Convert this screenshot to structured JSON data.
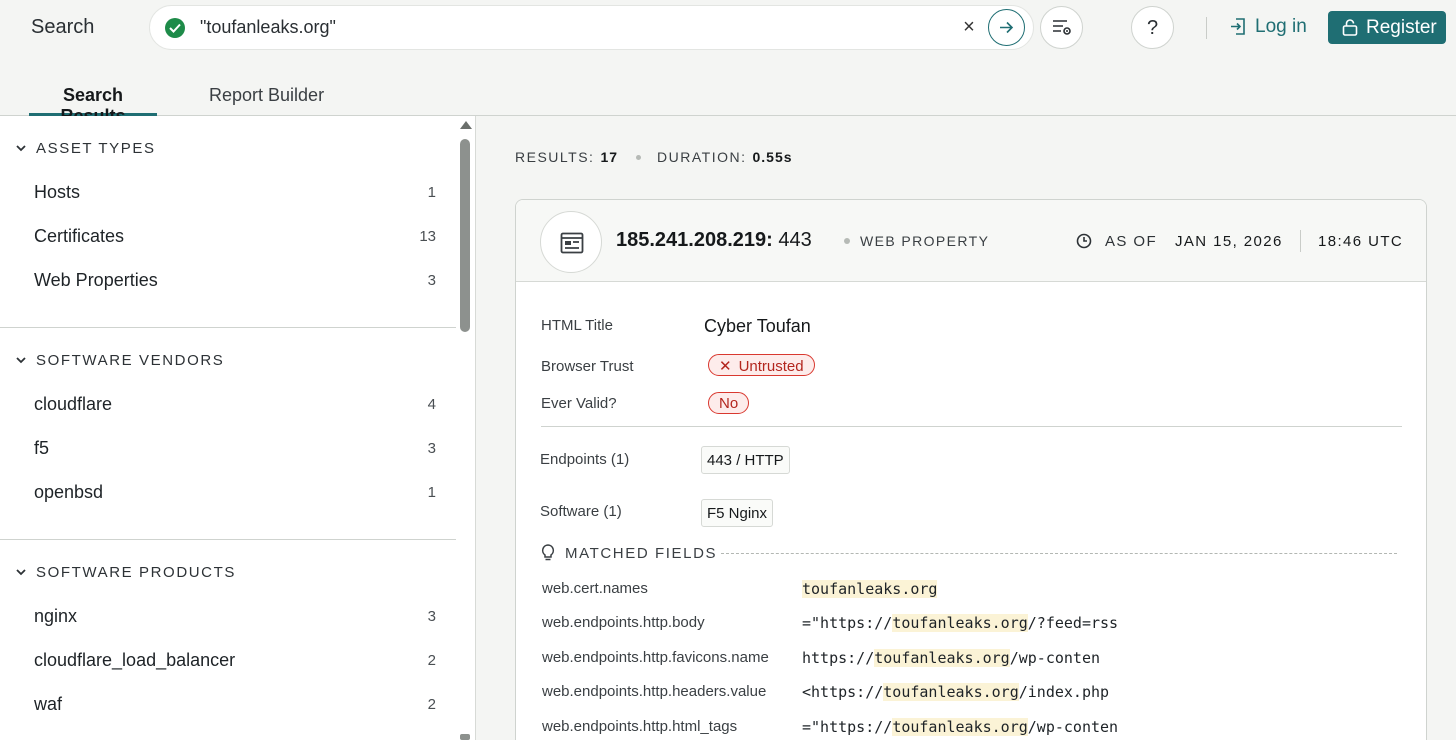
{
  "header": {
    "search_label": "Search",
    "search_value": "\"toufanleaks.org\"",
    "clear_icon": "×",
    "help_label": "?",
    "login_label": "Log in",
    "register_label": "Register",
    "accent_color": "#1f6e73",
    "icons": [
      "check-circle-icon",
      "close-icon",
      "arrow-right-icon",
      "filter-settings-icon",
      "help-icon",
      "login-icon",
      "lock-icon"
    ]
  },
  "tabs": [
    {
      "label": "Search Results",
      "active": true
    },
    {
      "label": "Report Builder",
      "active": false
    }
  ],
  "sidebar": {
    "facets": [
      {
        "title": "ASSET TYPES",
        "items": [
          {
            "label": "Hosts",
            "count": "1"
          },
          {
            "label": "Certificates",
            "count": "13"
          },
          {
            "label": "Web Properties",
            "count": "3"
          }
        ]
      },
      {
        "title": "SOFTWARE VENDORS",
        "items": [
          {
            "label": "cloudflare",
            "count": "4"
          },
          {
            "label": "f5",
            "count": "3"
          },
          {
            "label": "openbsd",
            "count": "1"
          }
        ]
      },
      {
        "title": "SOFTWARE PRODUCTS",
        "items": [
          {
            "label": "nginx",
            "count": "3"
          },
          {
            "label": "cloudflare_load_balancer",
            "count": "2"
          },
          {
            "label": "waf",
            "count": "2"
          }
        ]
      }
    ]
  },
  "results": {
    "results_label": "RESULTS:",
    "results_value": "17",
    "duration_label": "DURATION:",
    "duration_value": "0.55s"
  },
  "card": {
    "ip": "185.241.208.219:",
    "port": "443",
    "type": "WEB PROPERTY",
    "as_of_label": "AS OF",
    "date": "JAN 15, 2026",
    "time": "18:46 UTC",
    "html_title_label": "HTML Title",
    "html_title_value": "Cyber Toufan",
    "browser_trust_label": "Browser Trust",
    "browser_trust_value": "Untrusted",
    "ever_valid_label": "Ever Valid?",
    "ever_valid_value": "No",
    "endpoints_label": "Endpoints (1)",
    "endpoints_value": "443 / HTTP",
    "software_label": "Software (1)",
    "software_value": "F5 Nginx",
    "matched_fields_label": "MATCHED FIELDS",
    "matched_fields": [
      {
        "name": "web.cert.names",
        "pre": "",
        "match": "toufanleaks.org",
        "post": ""
      },
      {
        "name": "web.endpoints.http.body",
        "pre": "=\"https://",
        "match": "toufanleaks.org",
        "post": "/?feed=rss"
      },
      {
        "name": "web.endpoints.http.favicons.name",
        "pre": "https://",
        "match": "toufanleaks.org",
        "post": "/wp-conten"
      },
      {
        "name": "web.endpoints.http.headers.value",
        "pre": "<https://",
        "match": "toufanleaks.org",
        "post": "/index.php"
      },
      {
        "name": "web.endpoints.http.html_tags",
        "pre": "=\"https://",
        "match": "toufanleaks.org",
        "post": "/wp-conten"
      }
    ],
    "danger_color": "#d9382f",
    "highlight_color": "#fbf3d6"
  }
}
